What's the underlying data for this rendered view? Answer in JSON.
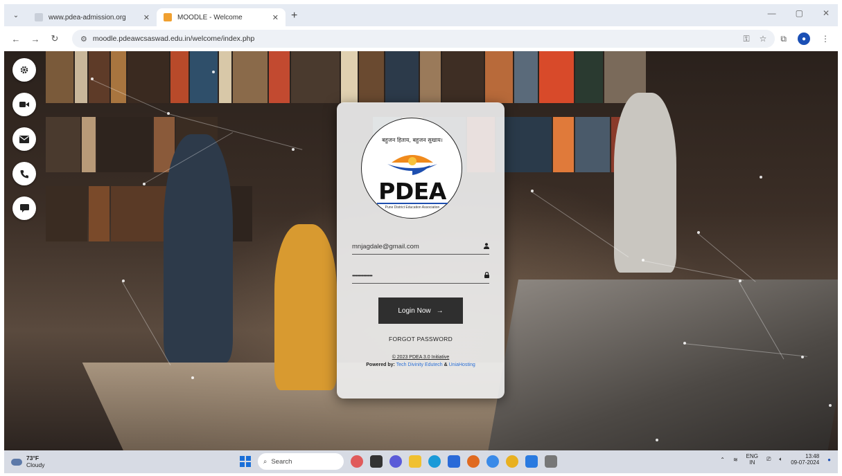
{
  "browser": {
    "tabs": [
      {
        "title": "www.pdea-admission.org",
        "active": false
      },
      {
        "title": "MOODLE - Welcome",
        "active": true
      }
    ],
    "url": "moodle.pdeawcsaswad.edu.in/welcome/index.php"
  },
  "login": {
    "logo": {
      "tagline": "बहुजन हिताय, बहुजन सुखाय।",
      "name": "PDEA",
      "subtitle": "Pune District Education Association"
    },
    "username_value": "mnjagdale@gmail.com",
    "password_value": "••••••••••••••••",
    "login_button": "Login Now",
    "forgot_password": "FORGOT PASSWORD",
    "copyright": "© 2023 PDEA 3.0 Initiative",
    "powered_by_prefix": "Powered by:",
    "powered_by_1": "Tech Divinity Edutech",
    "powered_by_amp": "&",
    "powered_by_2": "UniaHosting"
  },
  "side_buttons": [
    "gear-icon",
    "video-icon",
    "mail-icon",
    "phone-icon",
    "chat-icon"
  ],
  "taskbar": {
    "weather_temp": "73°F",
    "weather_desc": "Cloudy",
    "search_placeholder": "Search",
    "lang_top": "ENG",
    "lang_bottom": "IN",
    "time": "13:48",
    "date": "09-07-2024"
  },
  "colors": {
    "accent_blue": "#1e4fb0",
    "logo_orange": "#f08a1c",
    "button_dark": "#2f2f2f"
  }
}
